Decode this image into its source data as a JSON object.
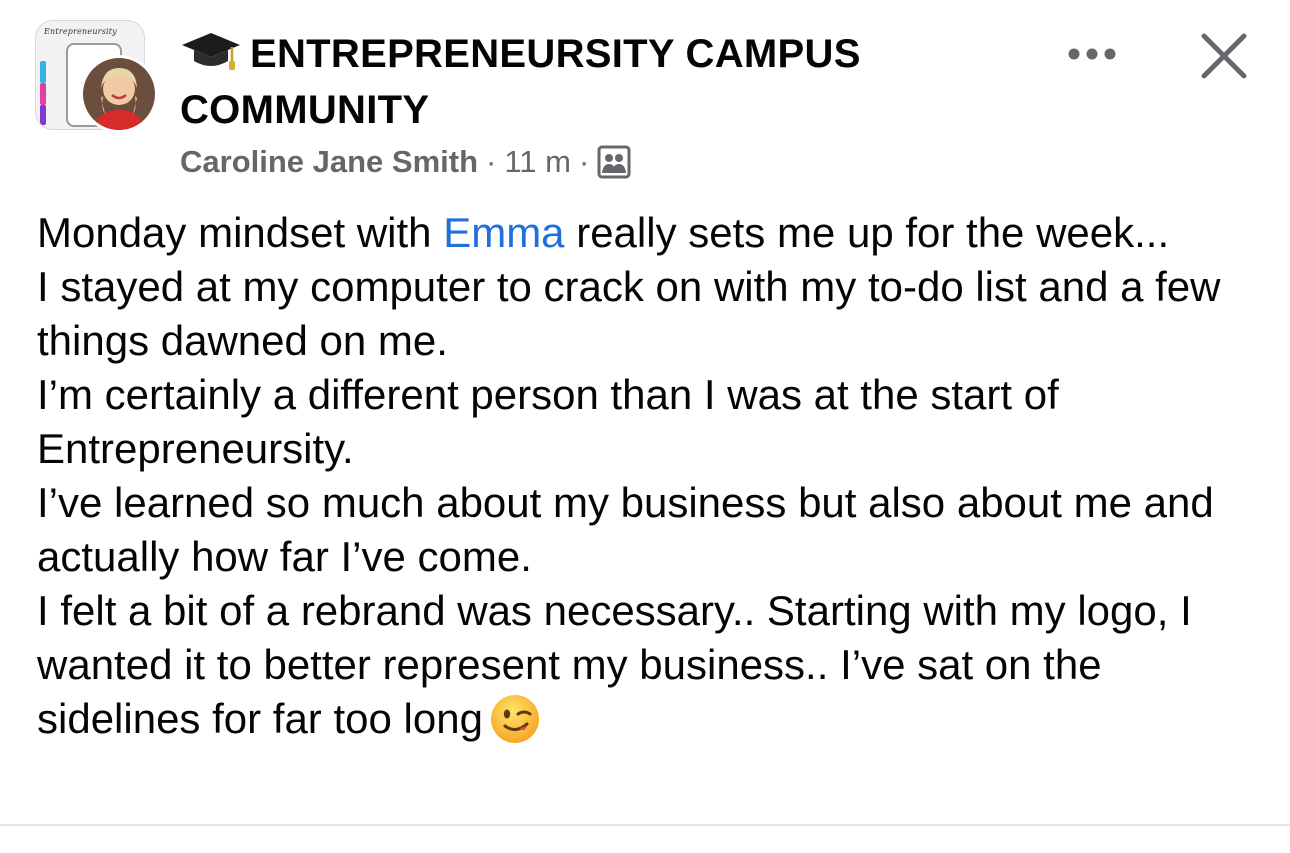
{
  "header": {
    "group_thumb_banner": "Entrepreneursity",
    "group_title": "ENTREPRENEURSITY CAMPUS COMMUNITY",
    "author": "Caroline Jane Smith",
    "separator": "·",
    "time": "11 m",
    "icons": {
      "group_icon": "graduation-cap-icon",
      "audience": "group-members-icon",
      "more": "more-dots-icon",
      "close": "close-icon"
    }
  },
  "post": {
    "line1_before": "Monday mindset with ",
    "mention": "Emma",
    "line1_after": " really sets me up for the week...",
    "line2": "I stayed at my computer to crack on with my to-do list and a few things dawned on me.",
    "line3": "I’m certainly a different person than I was at the start of Entrepreneursity.",
    "line4": "I’ve learned so much about my business but also about me and actually how far I’ve come.",
    "line5": "I felt a bit of a rebrand was necessary.. Starting with my logo, I wanted it to better represent my business.. I’ve sat on the sidelines for far too long",
    "emoji": "winking-face-icon"
  },
  "colors": {
    "text": "#050505",
    "meta": "#65676b",
    "mention": "#216fdb",
    "divider": "#e4e6eb"
  }
}
